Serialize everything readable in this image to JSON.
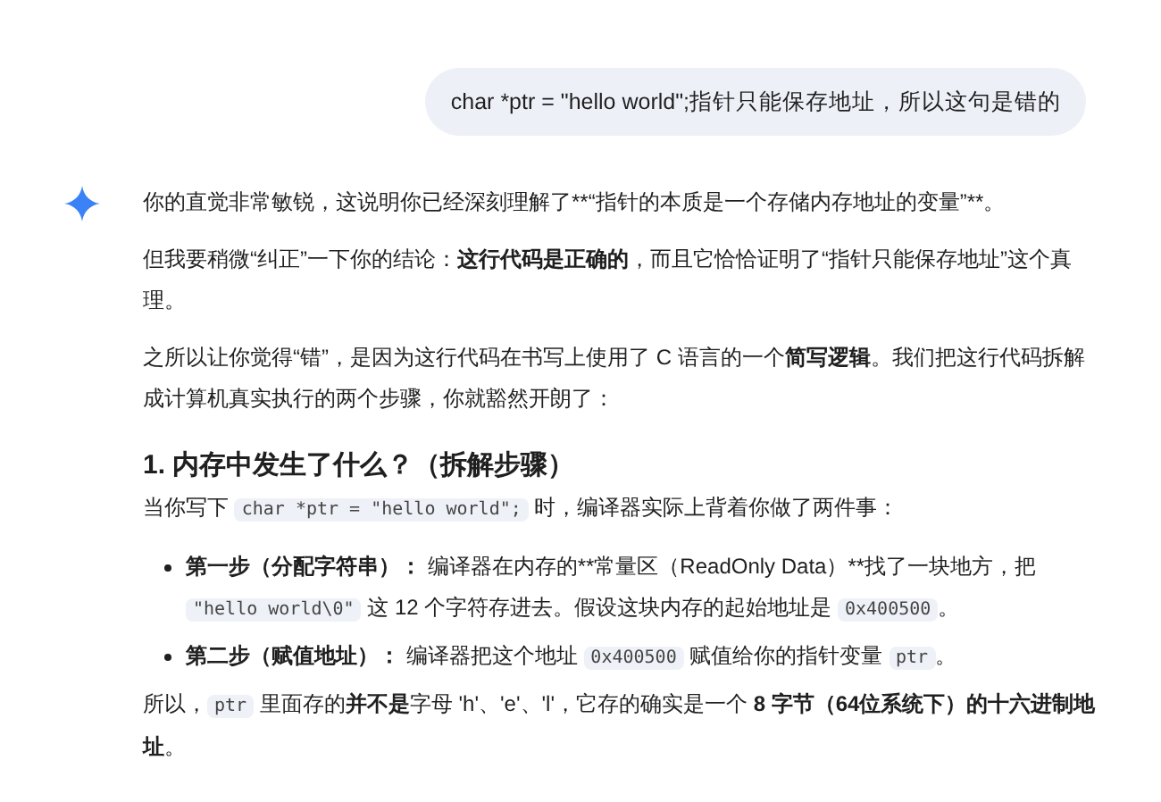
{
  "user_message": {
    "text": "char *ptr = \"hello world\";指针只能保存地址，所以这句是错的"
  },
  "response": [
    {
      "kind": "paragraph",
      "segments": [
        {
          "kind": "text",
          "text": "你的直觉非常敏锐，这说明你已经深刻理解了**“指针的本质是一个存储内存地址的变量”**。"
        }
      ]
    },
    {
      "kind": "paragraph",
      "segments": [
        {
          "kind": "text",
          "text": "但我要稍微“纠正”一下你的结论："
        },
        {
          "kind": "bold",
          "text": "这行代码是正确的"
        },
        {
          "kind": "text",
          "text": "，而且它恰恰证明了“指针只能保存地址”这个真理。"
        }
      ]
    },
    {
      "kind": "paragraph",
      "segments": [
        {
          "kind": "text",
          "text": "之所以让你觉得“错”，是因为这行代码在书写上使用了 C 语言的一个"
        },
        {
          "kind": "bold",
          "text": "简写逻辑"
        },
        {
          "kind": "text",
          "text": "。我们把这行代码拆解成计算机真实执行的两个步骤，你就豁然开朗了："
        }
      ]
    },
    {
      "kind": "heading",
      "segments": [
        {
          "kind": "text",
          "text": "1. 内存中发生了什么？（拆解步骤）"
        }
      ]
    },
    {
      "kind": "paragraph",
      "segments": [
        {
          "kind": "text",
          "text": "当你写下 "
        },
        {
          "kind": "code",
          "text": "char *ptr = \"hello world\";"
        },
        {
          "kind": "text",
          "text": " 时，编译器实际上背着你做了两件事："
        }
      ]
    },
    {
      "kind": "bullet",
      "segments": [
        {
          "kind": "bold",
          "text": "第一步（分配字符串）："
        },
        {
          "kind": "text",
          "text": " 编译器在内存的**常量区（ReadOnly Data）**找了一块地方，把 "
        },
        {
          "kind": "code",
          "text": "\"hello world\\0\""
        },
        {
          "kind": "text",
          "text": " 这 12 个字符存进去。假设这块内存的起始地址是 "
        },
        {
          "kind": "code",
          "text": "0x400500"
        },
        {
          "kind": "text",
          "text": "。"
        }
      ]
    },
    {
      "kind": "bullet",
      "segments": [
        {
          "kind": "bold",
          "text": "第二步（赋值地址）："
        },
        {
          "kind": "text",
          "text": " 编译器把这个地址 "
        },
        {
          "kind": "code",
          "text": "0x400500"
        },
        {
          "kind": "text",
          "text": " 赋值给你的指针变量 "
        },
        {
          "kind": "code",
          "text": "ptr"
        },
        {
          "kind": "text",
          "text": "。"
        }
      ]
    },
    {
      "kind": "paragraph",
      "segments": [
        {
          "kind": "text",
          "text": "所以，"
        },
        {
          "kind": "code",
          "text": "ptr"
        },
        {
          "kind": "text",
          "text": " 里面存的"
        },
        {
          "kind": "bold",
          "text": "并不是"
        },
        {
          "kind": "text",
          "text": "字母 'h'、'e'、'l'，它存的确实是一个 "
        },
        {
          "kind": "bold",
          "text": "8 字节（64位系统下）的十六进制地址"
        },
        {
          "kind": "text",
          "text": "。"
        }
      ]
    }
  ]
}
